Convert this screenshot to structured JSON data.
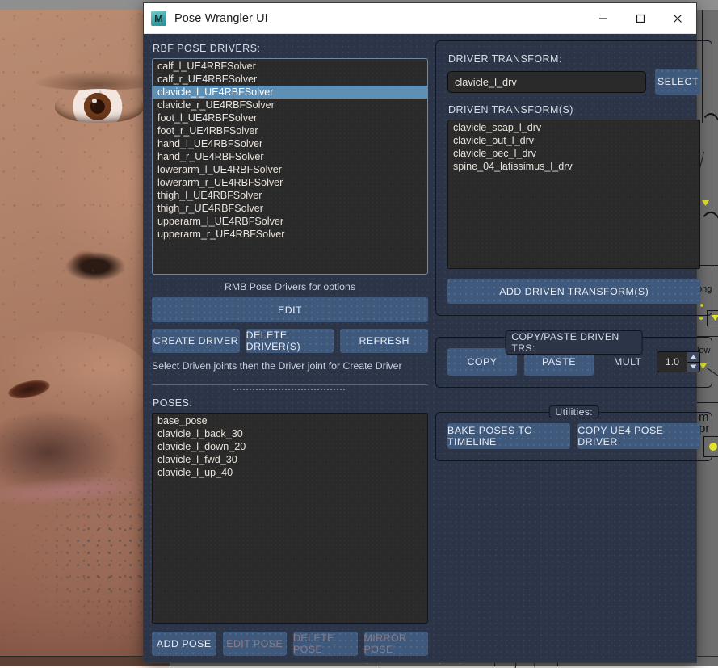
{
  "window": {
    "title": "Pose Wrangler UI",
    "app_icon": "maya-logo-icon",
    "logo_letter": "M",
    "minimize": "–",
    "maximize": "□",
    "close": "✕"
  },
  "left_panel": {
    "drivers_label": "RBF POSE DRIVERS:",
    "drivers": [
      {
        "label": "calf_l_UE4RBFSolver",
        "selected": false
      },
      {
        "label": "calf_r_UE4RBFSolver",
        "selected": false
      },
      {
        "label": "clavicle_l_UE4RBFSolver",
        "selected": true
      },
      {
        "label": "clavicle_r_UE4RBFSolver",
        "selected": false
      },
      {
        "label": "foot_l_UE4RBFSolver",
        "selected": false
      },
      {
        "label": "foot_r_UE4RBFSolver",
        "selected": false
      },
      {
        "label": "hand_l_UE4RBFSolver",
        "selected": false
      },
      {
        "label": "hand_r_UE4RBFSolver",
        "selected": false
      },
      {
        "label": "lowerarm_l_UE4RBFSolver",
        "selected": false
      },
      {
        "label": "lowerarm_r_UE4RBFSolver",
        "selected": false
      },
      {
        "label": "thigh_l_UE4RBFSolver",
        "selected": false
      },
      {
        "label": "thigh_r_UE4RBFSolver",
        "selected": false
      },
      {
        "label": "upperarm_l_UE4RBFSolver",
        "selected": false
      },
      {
        "label": "upperarm_r_UE4RBFSolver",
        "selected": false
      }
    ],
    "rmb_hint": "RMB Pose Drivers for options",
    "edit_label": "EDIT",
    "create_driver_label": "CREATE DRIVER",
    "delete_drivers_label": "DELETE DRIVER(S)",
    "refresh_label": "REFRESH",
    "create_hint": "Select Driven joints then the Driver joint for Create Driver",
    "poses_label": "POSES:",
    "poses": [
      "base_pose",
      "clavicle_l_back_30",
      "clavicle_l_down_20",
      "clavicle_l_fwd_30",
      "clavicle_l_up_40"
    ],
    "add_pose_label": "ADD POSE",
    "edit_pose_label": "EDIT POSE",
    "delete_pose_label": "DELETE POSE",
    "mirror_pose_label": "MIRROR POSE"
  },
  "right_panel": {
    "driver_transform_label": "DRIVER TRANSFORM:",
    "driver_transform_value": "clavicle_l_drv",
    "select_label": "SELECT",
    "driven_transforms_label": "DRIVEN TRANSFORM(S)",
    "driven_transforms": [
      "clavicle_scap_l_drv",
      "clavicle_out_l_drv",
      "clavicle_pec_l_drv",
      "spine_04_latissimus_l_drv"
    ],
    "add_driven_label": "ADD DRIVEN TRANSFORM(S)",
    "copy_paste_group_title": "COPY/PASTE DRIVEN TRS:",
    "copy_label": "COPY",
    "paste_label": "PASTE",
    "mult_label": "MULT",
    "mult_value": "1.0",
    "spin_up": "▲",
    "spin_down": "▼",
    "utilities_group_title": "Utilities:",
    "bake_poses_label": "BAKE POSES TO TIMELINE",
    "copy_ue4_label": "COPY UE4 POSE DRIVER"
  },
  "background": {
    "viewport_labels": [
      "ong",
      "low",
      "m",
      "pr"
    ]
  },
  "colors": {
    "dialog_bg": "#2c3448",
    "button": "#3f597c",
    "selection": "#5e8fb4",
    "list_bg": "#2a2a2a",
    "titlebar": "#ffffff",
    "text": "#e8ecf4",
    "keyframe": "#e3e32a"
  }
}
